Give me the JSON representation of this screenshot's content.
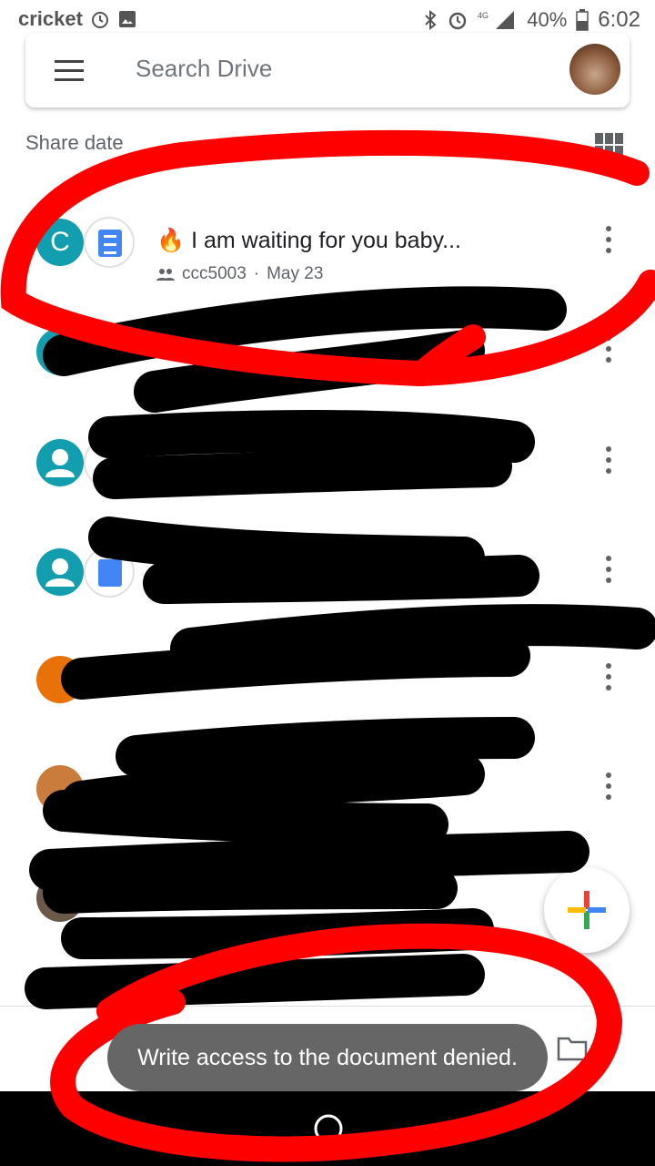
{
  "status_bar": {
    "carrier": "cricket",
    "battery": "40%",
    "time": "6:02"
  },
  "search": {
    "placeholder": "Search Drive"
  },
  "sort": {
    "label": "Share date"
  },
  "files": [
    {
      "avatar_letter": "C",
      "avatar_color": "#129eaf",
      "title": "🔥 I am waiting for you baby...",
      "owner": "ccc5003",
      "date": "May 23"
    }
  ],
  "toast": {
    "message": "Write access to the document denied."
  },
  "colors": {
    "scribble_red": "#ff0000",
    "scribble_black": "#000000",
    "teal": "#129eaf",
    "orange": "#e8710a"
  }
}
